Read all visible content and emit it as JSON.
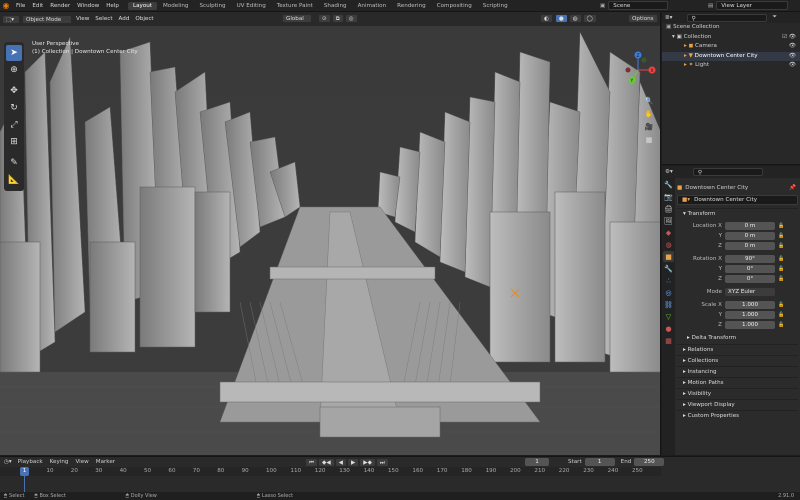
{
  "topbar": {
    "menus": [
      "File",
      "Edit",
      "Render",
      "Window",
      "Help"
    ],
    "workspaces": [
      "Layout",
      "Modeling",
      "Sculpting",
      "UV Editing",
      "Texture Paint",
      "Shading",
      "Animation",
      "Rendering",
      "Compositing",
      "Scripting"
    ],
    "active_ws": "Layout",
    "scene": "Scene",
    "view_layer": "View Layer"
  },
  "viewport": {
    "mode": "Object Mode",
    "menus": [
      "View",
      "Select",
      "Add",
      "Object"
    ],
    "orientation": "Global",
    "options": "Options",
    "perspective": "User Perspective",
    "collection_info": "(1) Collection | Downtown Center City",
    "gizmo_axes": [
      "X",
      "Y",
      "Z"
    ]
  },
  "outliner": {
    "root": "Scene Collection",
    "collection": "Collection",
    "items": [
      "Camera",
      "Downtown Center City",
      "Light"
    ]
  },
  "properties": {
    "object_name": "Downtown Center City",
    "datablock": "Downtown Center City",
    "transform_title": "Transform",
    "location": {
      "label": "Location X",
      "x": "0 m",
      "y": "0 m",
      "z": "0 m"
    },
    "rotation": {
      "label": "Rotation X",
      "x": "90°",
      "y": "0°",
      "z": "0°"
    },
    "mode_label": "Mode",
    "mode": "XYZ Euler",
    "scale": {
      "label": "Scale X",
      "x": "1.000",
      "y": "1.000",
      "z": "1.000"
    },
    "axis_y": "Y",
    "axis_z": "Z",
    "delta": "Delta Transform",
    "panels": [
      "Relations",
      "Collections",
      "Instancing",
      "Motion Paths",
      "Visibility",
      "Viewport Display",
      "Custom Properties"
    ]
  },
  "timeline": {
    "menus": [
      "Playback",
      "Keying",
      "View",
      "Marker"
    ],
    "current": "1",
    "start_label": "Start",
    "start": "1",
    "end_label": "End",
    "end": "250",
    "ticks": [
      "0",
      "10",
      "20",
      "30",
      "40",
      "50",
      "60",
      "70",
      "80",
      "90",
      "100",
      "110",
      "120",
      "130",
      "140",
      "150",
      "160",
      "170",
      "180",
      "190",
      "200",
      "210",
      "220",
      "230",
      "240",
      "250"
    ]
  },
  "status": {
    "select": "Select",
    "box": "Box Select",
    "dolly": "Dolly View",
    "lasso": "Lasso Select",
    "version": "2.91.0"
  },
  "colors": {
    "accent": "#4772b3",
    "bg": "#1d1d1d",
    "viewport": "#3a3a3a"
  }
}
